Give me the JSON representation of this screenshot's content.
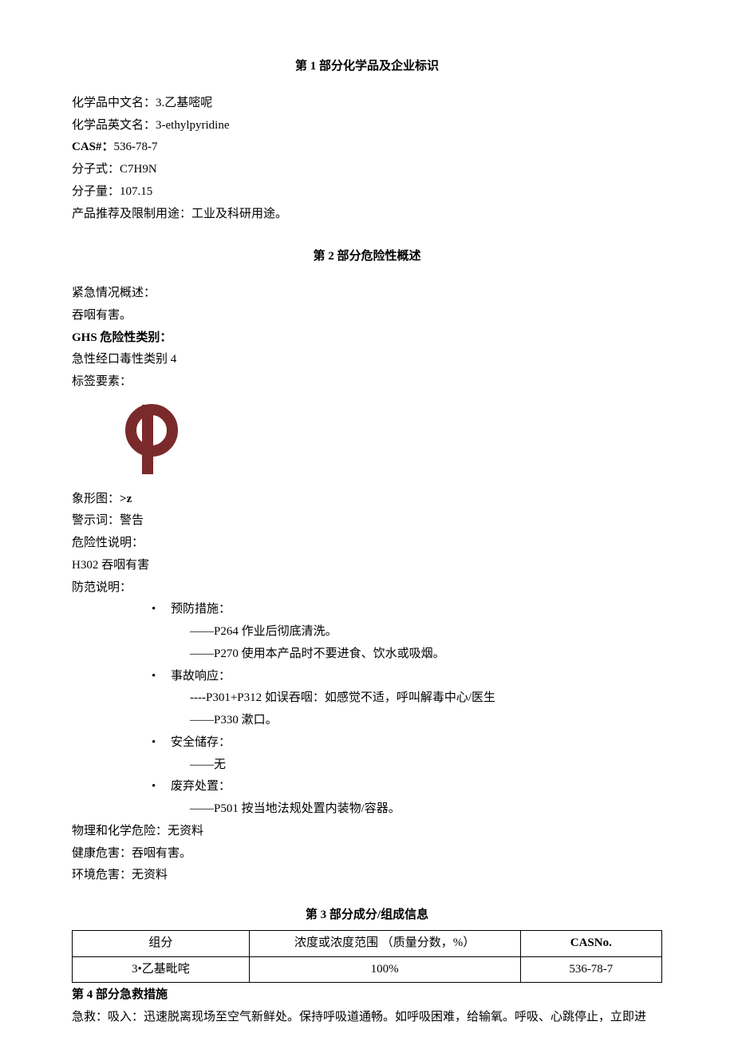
{
  "section1": {
    "title": "第 1 部分化学品及企业标识",
    "name_cn_label": "化学品中文名：",
    "name_cn": "3.乙基嘧呢",
    "name_en_label": "化学品英文名：",
    "name_en": "3-ethylpyridine",
    "cas_label": "CAS#：",
    "cas": "536-78-7",
    "formula_label": "分子式：",
    "formula": "C7H9N",
    "mw_label": "分子量：",
    "mw": "107.15",
    "use_label": "产品推荐及限制用途：",
    "use": "工业及科研用途。"
  },
  "section2": {
    "title": "第 2 部分危险性概述",
    "emergency_label": "紧急情况概述：",
    "emergency_text": "吞咽有害。",
    "ghs_label": "GHS 危险性类别：",
    "ghs_text": "急性经口毒性类别 4",
    "label_elements": "标签要素：",
    "pictogram_label": "象形图：",
    "pictogram_text": ">z",
    "signal_label": "警示词：",
    "signal": "警告",
    "hazard_label": "危险性说明：",
    "hazard_text": "H302 吞咽有害",
    "precaution_label": "防范说明：",
    "prevention_h": "预防措施：",
    "prevention_1": "——P264 作业后彻底清洗。",
    "prevention_2": "——P270 使用本产品时不要进食、饮水或吸烟。",
    "response_h": "事故响应：",
    "response_1": "----P301+P312 如误吞咽：如感觉不适，呼叫解毒中心/医生",
    "response_2": "——P330 漱口。",
    "storage_h": "安全储存：",
    "storage_1": "——无",
    "disposal_h": "废弃处置：",
    "disposal_1": "——P501 按当地法规处置内装物/容器。",
    "phys_label": "物理和化学危险：",
    "phys_text": "无资料",
    "health_label": "健康危害：",
    "health_text": "吞咽有害。",
    "env_label": "环境危害：",
    "env_text": "无资料"
  },
  "section3": {
    "title": "第 3 部分成分/组成信息",
    "headers": {
      "c1": "组分",
      "c2": "浓度或浓度范围 （质量分数，%）",
      "c3": "CASNo."
    },
    "row1": {
      "c1": "3•乙基毗咤",
      "c2": "100%",
      "c3": "536-78-7"
    }
  },
  "section4": {
    "title": "第 4 部分急救措施",
    "first_aid_label": "急救：",
    "inhale_label": "吸入：",
    "inhale_text": "迅速脱离现场至空气新鲜处。保持呼吸道通畅。如呼吸困难，给输氧。呼吸、心跳停止，立即进"
  }
}
